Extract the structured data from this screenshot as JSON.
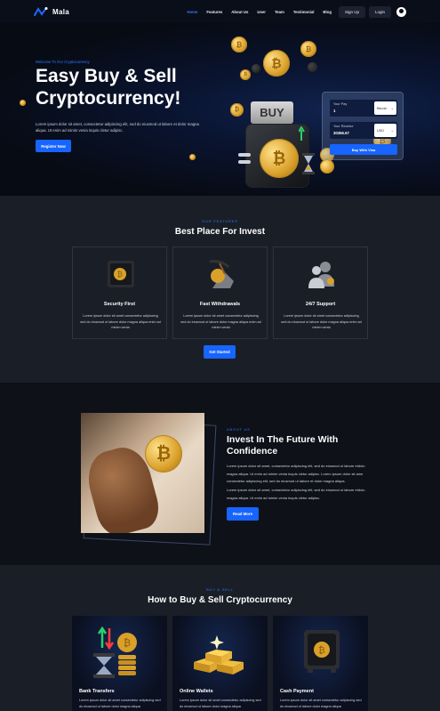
{
  "brand": {
    "name": "Mala"
  },
  "nav": {
    "items": [
      "Home",
      "Features",
      "About Us",
      "User",
      "Team",
      "Testimonial",
      "Blog"
    ],
    "active": "Home",
    "signup": "Sign Up",
    "login": "Login"
  },
  "hero": {
    "eyebrow": "Welcome To Our Cryptocurrency",
    "title": "Easy Buy & Sell Cryptocurrency!",
    "description": "Lorem ipsum dolor sit amet, consectetur adipiscing elit, sed do eiusmod ut labore et dolor magna aliqua. Ut enim ad minim venia inquis cletur adipisc.",
    "cta": "Register Now",
    "buy_sign": "BUY"
  },
  "trade": {
    "pay_label": "Your Pay",
    "pay_value": "1",
    "pay_currency": "Bitcoin",
    "receive_label": "Your Receive",
    "receive_value": "30356.67",
    "receive_currency": "USD",
    "button": "Buy With Visa"
  },
  "features": {
    "eyebrow": "OUR FEATURES",
    "title": "Best Place For Invest",
    "cards": [
      {
        "title": "Security First",
        "icon": "safe-icon",
        "description": "Lorem ipsum dolor sit amet consectetur adipiscing sed do eiusmod ut labore dolor magna aliqua enim ad minim venia"
      },
      {
        "title": "Fast Withdrawals",
        "icon": "pickaxe-coin-icon",
        "description": "Lorem ipsum dolor sit amet consectetur adipiscing sed do eiusmod ut labore dolor magna aliqua enim ad minim venia"
      },
      {
        "title": "24/7 Support",
        "icon": "support-people-icon",
        "description": "Lorem ipsum dolor sit amet consectetur adipiscing sed do eiusmod ut labore dolor magna aliqua enim ad minim venia"
      }
    ],
    "cta": "Get Started"
  },
  "about": {
    "eyebrow": "ABOUT US",
    "title": "Invest In The Future With Confidence",
    "paragraph1": "Lorem ipsum dolor sit amet, consectetur adipiscing elit, sed do eiusmod ut labore etdolo magna aliqua. Ut enim ad minim venia inquis cletur adipisc. Lorem ipsum dolor sit ame consectetur adipiscing elit, sed do eiusmod ut labore et dolor magna aliqua.",
    "paragraph2": "Lorem ipsum dolor sit amet, consectetur adipiscing elit, sed do eiusmod ut labore etdolo magna aliqua. Ut enim ad minim venia inquis cletur adipisc.",
    "cta": "Read More"
  },
  "howto": {
    "eyebrow": "BUY & SELL",
    "title": "How to Buy & Sell Cryptocurrency",
    "cards": [
      {
        "title": "Bank Transfers",
        "icon": "hourglass-coins-icon",
        "description": "Lorem ipsum dolor sit amet consectetur adipiscing sed do eiusmod ut labore dolor magna aliqua"
      },
      {
        "title": "Online Wallets",
        "icon": "gold-bars-icon",
        "description": "Lorem ipsum dolor sit amet consectetur adipiscing sed do eiusmod ut labore dolor magna aliqua"
      },
      {
        "title": "Cash Payment",
        "icon": "safe-icon",
        "description": "Lorem ipsum dolor sit amet consectetur adipiscing sed do eiusmod ut labore dolor magna aliqua"
      }
    ]
  }
}
